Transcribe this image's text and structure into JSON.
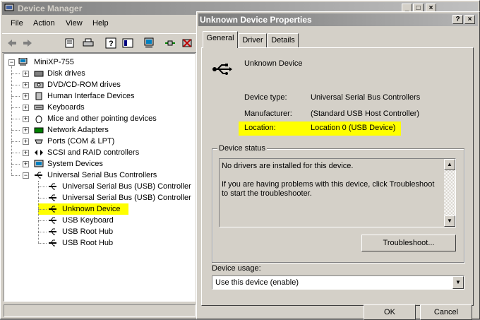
{
  "device_manager": {
    "title": "Device Manager",
    "menu": [
      "File",
      "Action",
      "View",
      "Help"
    ],
    "toolbar_icons": [
      "back-arrow-icon",
      "forward-arrow-icon",
      "properties-icon",
      "print-icon",
      "help-icon",
      "view-icon",
      "computer-icon",
      "scan-hardware-icon",
      "uninstall-icon"
    ],
    "tree": {
      "root": "MiniXP-755",
      "categories": [
        {
          "label": "Disk drives",
          "icon": "disk-icon"
        },
        {
          "label": "DVD/CD-ROM drives",
          "icon": "cdrom-icon"
        },
        {
          "label": "Human Interface Devices",
          "icon": "hid-icon"
        },
        {
          "label": "Keyboards",
          "icon": "keyboard-icon"
        },
        {
          "label": "Mice and other pointing devices",
          "icon": "mouse-icon"
        },
        {
          "label": "Network Adapters",
          "icon": "network-icon"
        },
        {
          "label": "Ports (COM & LPT)",
          "icon": "port-icon"
        },
        {
          "label": "SCSI and RAID controllers",
          "icon": "scsi-icon"
        },
        {
          "label": "System Devices",
          "icon": "system-icon"
        },
        {
          "label": "Universal Serial Bus Controllers",
          "icon": "usb-icon"
        }
      ],
      "usb_children": [
        "Universal Serial Bus (USB) Controller",
        "Universal Serial Bus (USB) Controller",
        "Unknown Device",
        "USB Keyboard",
        "USB Root Hub",
        "USB Root Hub"
      ],
      "highlighted": "Unknown Device",
      "highlight_color": "#ffff00"
    }
  },
  "properties": {
    "title": "Unknown Device Properties",
    "tabs": [
      "General",
      "Driver",
      "Details"
    ],
    "active_tab": "General",
    "device_name": "Unknown Device",
    "fields": [
      {
        "label": "Device type:",
        "value": "Universal Serial Bus Controllers"
      },
      {
        "label": "Manufacturer:",
        "value": "(Standard USB Host Controller)"
      },
      {
        "label": "Location:",
        "value": "Location 0 (USB Device)"
      }
    ],
    "status_group_label": "Device status",
    "status_line1": "No drivers are installed for this device.",
    "status_line2": "If you are having problems with this device, click Troubleshoot to start the troubleshooter.",
    "troubleshoot_label": "Troubleshoot...",
    "usage_label": "Device usage:",
    "usage_value": "Use this device (enable)",
    "ok_label": "OK",
    "cancel_label": "Cancel"
  }
}
